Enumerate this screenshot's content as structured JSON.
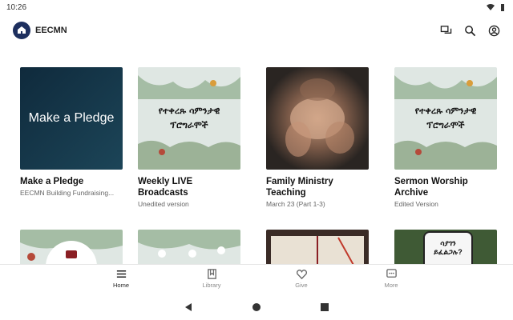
{
  "status_bar": {
    "time": "10:26"
  },
  "app_bar": {
    "title": "EECMN"
  },
  "cards": [
    {
      "title": "Make a Pledge",
      "subtitle": "EECMN Building Fundraising...",
      "thumb_text": "Make a Pledge"
    },
    {
      "title": "Weekly LIVE Broadcasts",
      "subtitle": "Unedited version",
      "thumb_line1": "የተቀረጹ ሳምንታዊ",
      "thumb_line2": "ፕሮግራሞች"
    },
    {
      "title": "Family Ministry Teaching",
      "subtitle": "March 23 (Part 1-3)"
    },
    {
      "title": "Sermon Worship Archive",
      "subtitle": "Edited Version",
      "thumb_line1": "የተቀረጹ ሳምንታዊ",
      "thumb_line2": "ፕሮግራሞች"
    }
  ],
  "row2": {
    "card4_line1": "ሳያገን",
    "card4_line2": "ይፈልጋሉ?"
  },
  "nav": {
    "home": "Home",
    "library": "Library",
    "give": "Give",
    "more": "More"
  },
  "colors": {
    "brand": "#1d2f5e",
    "pledge_bg": "#16384a",
    "amharic_bg": "#dfe7e3"
  }
}
